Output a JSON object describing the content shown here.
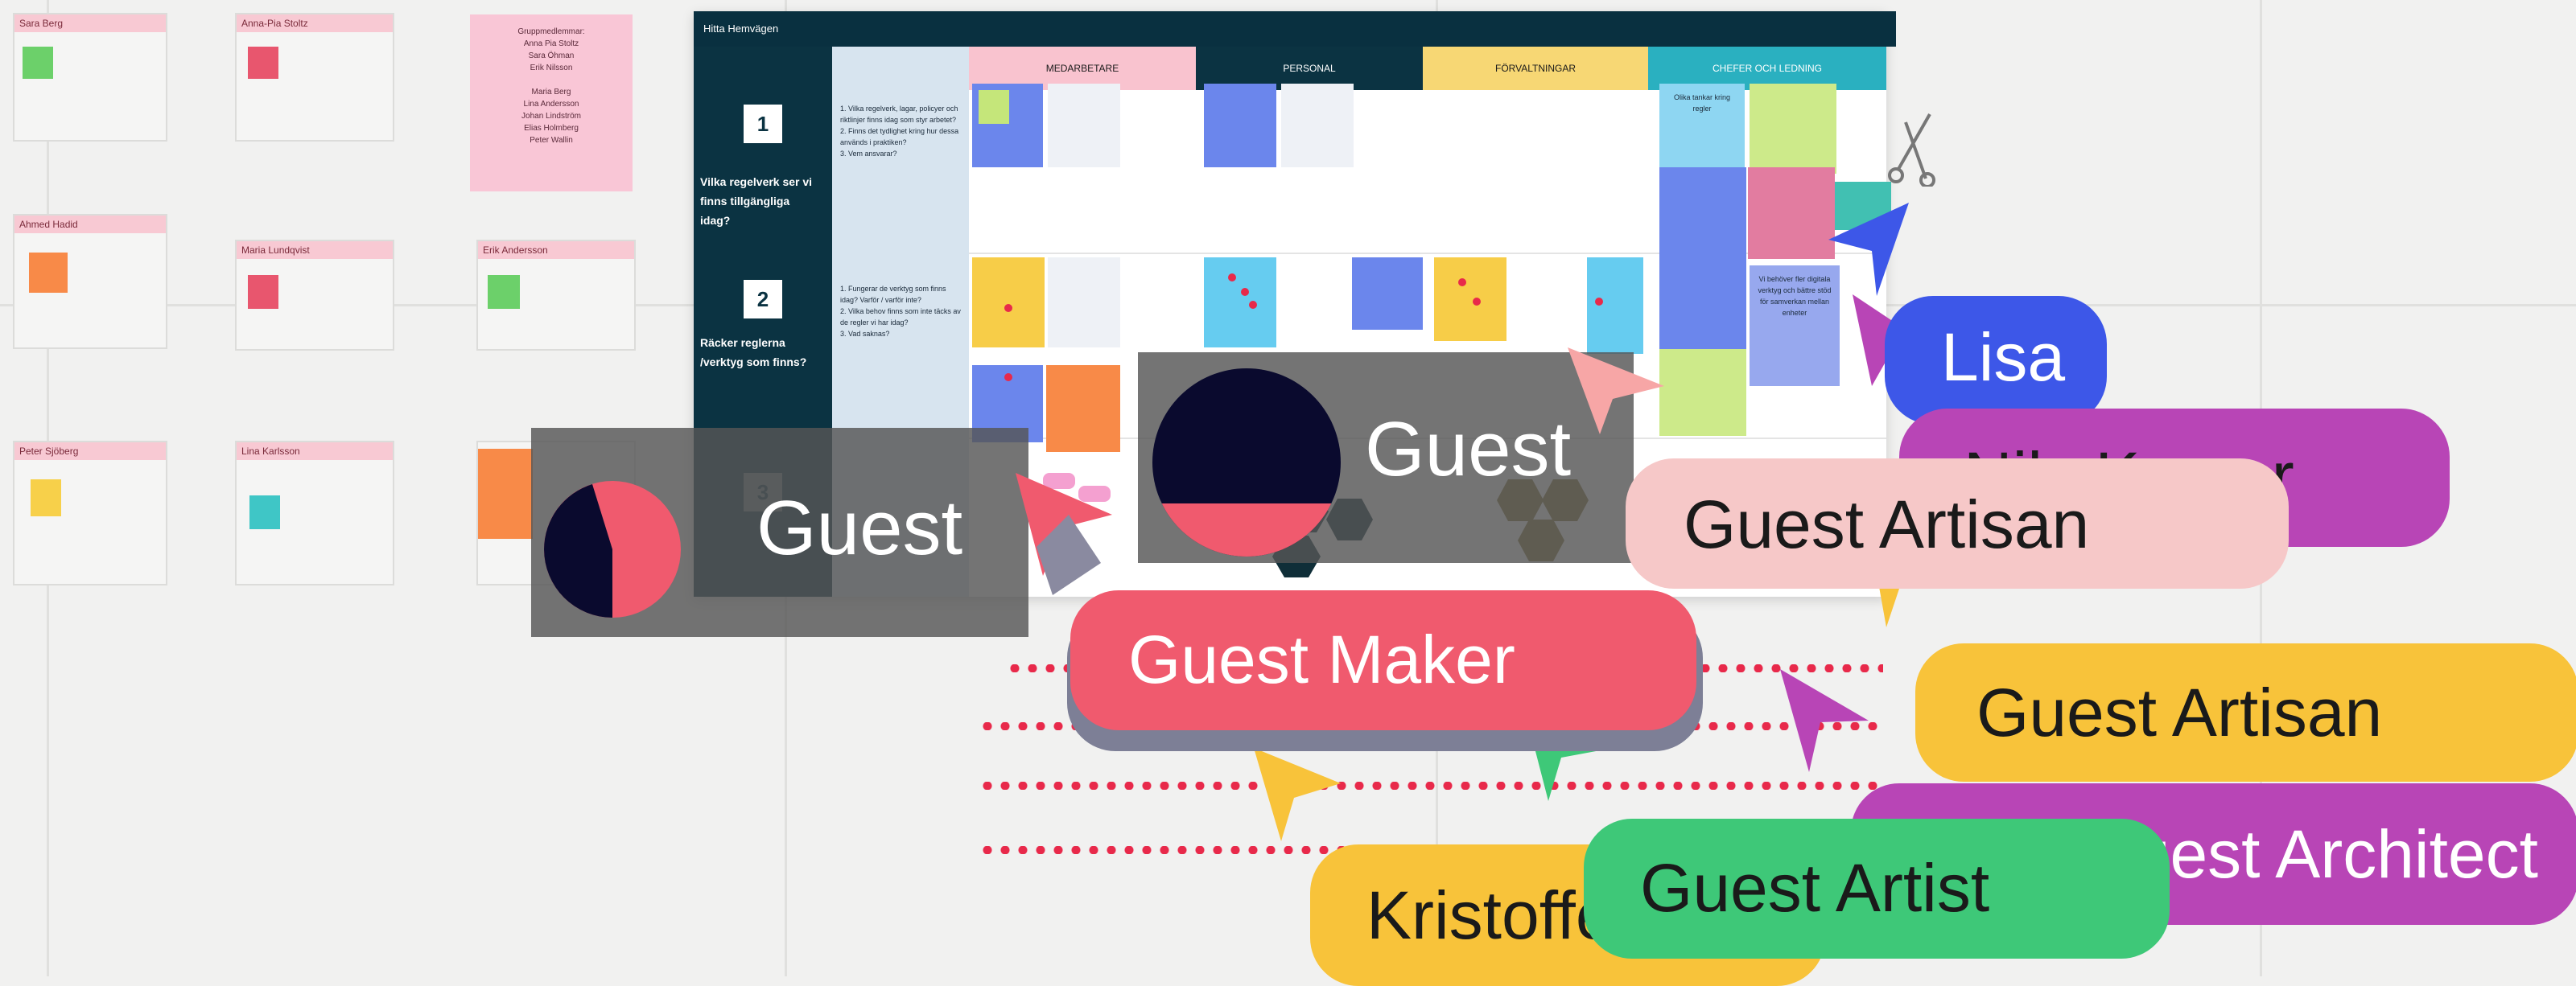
{
  "board": {
    "title": "Hitta Hemvägen",
    "columns": [
      {
        "label": "MEDARBETARE",
        "color": "#f9c3cf"
      },
      {
        "label": "PERSONAL",
        "color": "#0b3342"
      },
      {
        "label": "FÖRVALTNINGAR",
        "color": "#f7d774"
      },
      {
        "label": "CHEFER OCH LEDNING",
        "color": "#2ab0c0"
      }
    ],
    "steps": [
      {
        "number": "1",
        "question": "Vilka regelverk ser vi finns tillgängliga idag?"
      },
      {
        "number": "2",
        "question": "Räcker reglerna /verktyg som finns?"
      },
      {
        "number": "3",
        "question": ""
      }
    ],
    "descriptions": [
      "1. Vilka regelverk, lagar, policyer och riktlinjer finns idag som styr arbetet?\n2. Finns det tydlighet kring hur dessa används i praktiken?\n3. Vem ansvarar?",
      "1. Fungerar de verktyg som finns idag? Varför / varför inte?\n2. Vilka behov finns som inte täcks av de regler vi har idag?\n3. Vad saknas?"
    ],
    "stickies_text": [
      "Olika tankar kring regler",
      "Vi behöver fler digitala verktyg och bättre stöd för samverkan mellan enheter"
    ]
  },
  "left_frames": {
    "labels": [
      "Sara Berg",
      "Anna-Pia Stoltz",
      "Ahmed Hadid",
      "Maria Lundqvist",
      "Erik Andersson",
      "Peter Sjöberg",
      "Lina Karlsson"
    ],
    "pink_note": "Gruppmedlemmar:\nAnna Pia Stoltz\nSara Öhman\nErik Nilsson\n\nMaria Berg\nLina Andersson\nJohan Lindström\nElias Holmberg\nPeter Wallin"
  },
  "collaborators": {
    "guest_left": "Guest",
    "guest_center": "Guest",
    "pills": [
      {
        "name": "Lisa",
        "bg": "#3d57e8",
        "fg": "#ffffff"
      },
      {
        "name": "Nils Kumar",
        "bg": "#b845b6",
        "fg": "#1a1a1a"
      },
      {
        "name": "Guest Artisan",
        "bg": "#f6c8c8",
        "fg": "#1a1a1a"
      },
      {
        "name": "Guest Maker",
        "bg": "#f05a6e",
        "fg": "#ffffff"
      },
      {
        "name": "Guest Artisan",
        "bg": "#f8c33a",
        "fg": "#1a1a1a"
      },
      {
        "name": "Guest Architect",
        "bg": "#b845b6",
        "fg": "#ffffff"
      },
      {
        "name": "Kristoffer",
        "bg": "#f8c33a",
        "fg": "#1a1a1a"
      },
      {
        "name": "Guest Artist",
        "bg": "#3ec878",
        "fg": "#1a1a1a"
      }
    ],
    "cursor_colors": {
      "blue": "#3d57e8",
      "purple": "#b845b6",
      "pink": "#f6c8c8",
      "red": "#f05a6e",
      "yellow": "#f8c33a",
      "green": "#3ec878",
      "salmon": "#f7a6a6"
    }
  }
}
